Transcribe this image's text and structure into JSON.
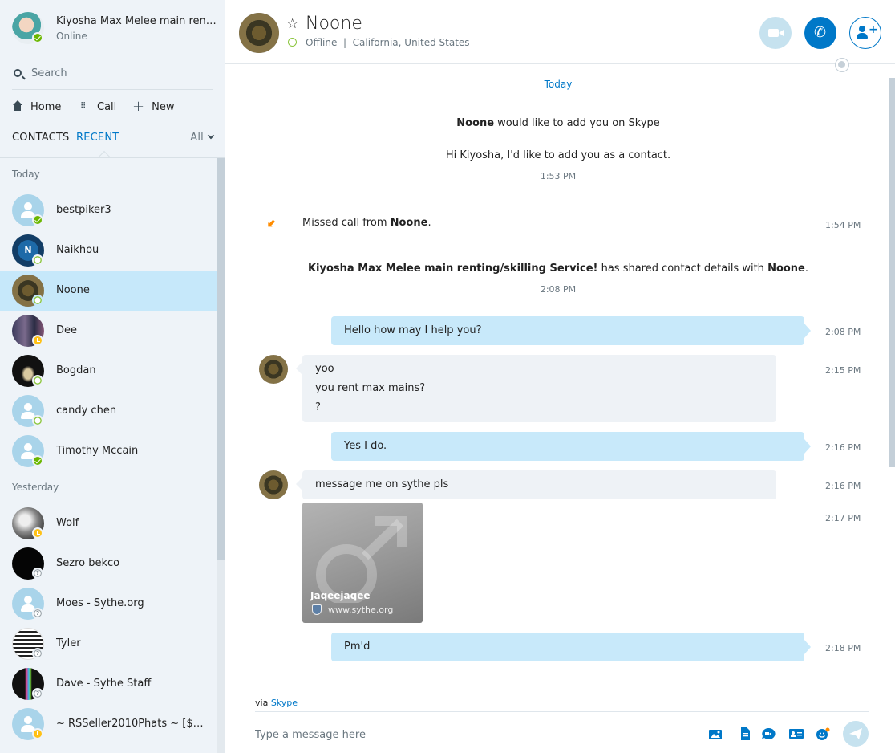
{
  "profile": {
    "name": "Kiyosha Max Melee main renti...",
    "status": "Online"
  },
  "search": {
    "placeholder": "Search"
  },
  "nav": {
    "home": "Home",
    "call": "Call",
    "new": "New"
  },
  "tabs": {
    "contacts": "CONTACTS",
    "recent": "RECENT",
    "filter": "All"
  },
  "sections": {
    "today": "Today",
    "yesterday": "Yesterday"
  },
  "contacts": [
    {
      "name": "bestpiker3",
      "status": "online"
    },
    {
      "name": "Naikhou",
      "status": "offline",
      "initial": "N"
    },
    {
      "name": "Noone",
      "status": "offline",
      "selected": true
    },
    {
      "name": "Dee",
      "status": "away"
    },
    {
      "name": "Bogdan",
      "status": "offline"
    },
    {
      "name": "candy chen",
      "status": "offline"
    },
    {
      "name": "Timothy Mccain",
      "status": "online"
    },
    {
      "name": "Wolf",
      "status": "away"
    },
    {
      "name": "Sezro bekco",
      "status": "unknown"
    },
    {
      "name": "Moes - Sythe.org",
      "status": "unknown"
    },
    {
      "name": "Tyler",
      "status": "unknown"
    },
    {
      "name": "Dave - Sythe Staff",
      "status": "unknown"
    },
    {
      "name": "~ RSSeller2010Phats ~ [$200...",
      "status": "away"
    }
  ],
  "header": {
    "name": "Noone",
    "status": "Offline",
    "location": "California, United States",
    "status_line": "Offline  |  California, United States"
  },
  "conversation": {
    "date": "Today",
    "request": {
      "bold": "Noone",
      "rest": " would like to add you on Skype"
    },
    "request_msg": "Hi Kiyosha, I'd like to add you as a contact.",
    "request_time": "1:53 PM",
    "missed": {
      "prefix": "Missed call from ",
      "bold": "Noone",
      "suffix": ".",
      "time": "1:54 PM"
    },
    "shared": {
      "bold1": "Kiyosha Max Melee main renting/skilling Service!",
      "mid": " has shared contact details with ",
      "bold2": "Noone",
      "suffix": ".",
      "time": "2:08 PM"
    },
    "messages": [
      {
        "dir": "out",
        "lines": [
          "Hello how may I help you?"
        ],
        "time": "2:08 PM"
      },
      {
        "dir": "in",
        "lines": [
          "yoo",
          "you rent max mains?",
          "?"
        ],
        "time": "2:15 PM"
      },
      {
        "dir": "out",
        "lines": [
          "Yes I do."
        ],
        "time": "2:16 PM"
      },
      {
        "dir": "in",
        "lines": [
          "message me on sythe pls"
        ],
        "time": "2:16 PM"
      },
      {
        "dir": "out",
        "lines": [
          "Pm'd"
        ],
        "time": "2:18 PM"
      }
    ],
    "link_card": {
      "title": "Jaqeejaqee",
      "url": "www.sythe.org",
      "time": "2:17 PM"
    }
  },
  "composer": {
    "via_prefix": "via ",
    "via_link": "Skype",
    "placeholder": "Type a message here"
  },
  "colors": {
    "accent": "#0078c8",
    "online": "#6bb700",
    "away": "#ffc116",
    "outgoing_bubble": "#c8e9fa",
    "incoming_bubble": "#eef2f6",
    "selected_row": "#c6e8fa",
    "missed_call": "#ff8c00"
  },
  "icons": {
    "search": "search-icon",
    "home": "home-icon",
    "call": "dialpad-icon",
    "new": "plus-icon",
    "favorite": "star-icon",
    "video": "video-icon",
    "phone": "phone-icon",
    "add_contact": "add-person-icon",
    "send": "send-icon"
  }
}
